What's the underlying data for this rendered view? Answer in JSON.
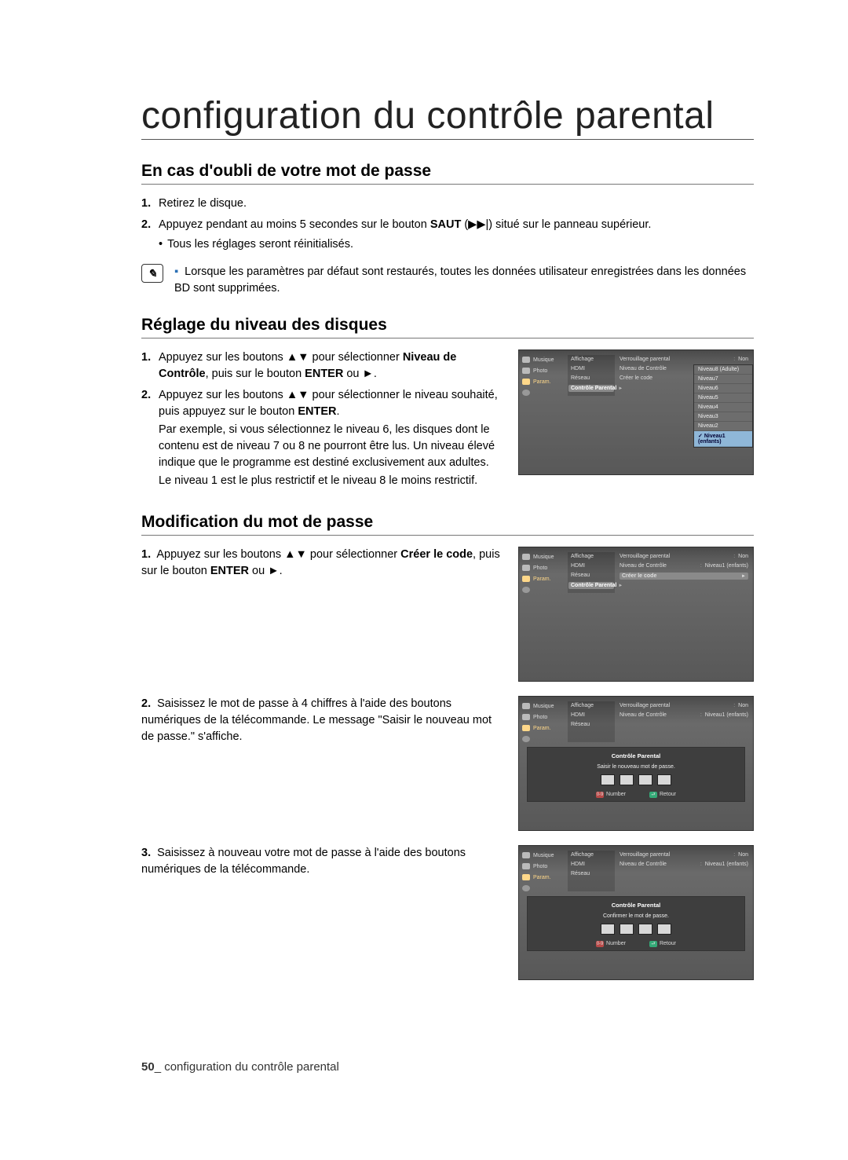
{
  "page": {
    "title": "configuration du contrôle parental",
    "footer_page": "50",
    "footer_sep": "_",
    "footer_text": "configuration du contrôle parental"
  },
  "s1": {
    "heading": "En cas d'oubli de votre mot de passe",
    "step1": "Retirez le disque.",
    "step2_a": "Appuyez pendant au moins 5 secondes sur le bouton ",
    "step2_b": "SAUT",
    "step2_c": " (▶▶|) situé sur le panneau supérieur.",
    "step2_bullet": "Tous les réglages seront réinitialisés.",
    "note": "Lorsque les paramètres par défaut sont restaurés, toutes les données utilisateur enregistrées dans les données BD sont supprimées."
  },
  "s2": {
    "heading": "Réglage du niveau des disques",
    "step1_a": "Appuyez sur les boutons ▲▼ pour sélectionner ",
    "step1_b": "Niveau de Contrôle",
    "step1_c": ", puis sur le bouton ",
    "step1_d": "ENTER",
    "step1_e": " ou ►.",
    "step2_a": "Appuyez sur les boutons ▲▼ pour sélectionner le niveau souhaité, puis appuyez sur le bouton ",
    "step2_b": "ENTER",
    "step2_c": ".",
    "step2_p1": "Par exemple, si vous sélectionnez le niveau 6, les disques dont le contenu est de niveau 7 ou 8 ne pourront être lus. Un niveau élevé indique que le programme est destiné exclusivement aux adultes.",
    "step2_p2": "Le niveau 1 est le plus restrictif et le niveau 8 le moins restrictif."
  },
  "s3": {
    "heading": "Modification du mot de passe",
    "step1_a": "Appuyez sur les boutons ▲▼ pour sélectionner ",
    "step1_b": "Créer le code",
    "step1_c": ", puis sur le bouton ",
    "step1_d": "ENTER",
    "step1_e": " ou ►.",
    "step2": "Saisissez le mot de passe à 4 chiffres à l'aide des boutons numériques de la télécommande. Le message \"Saisir le nouveau mot de passe.\" s'affiche.",
    "step3": "Saisissez à nouveau votre mot de passe à l'aide des boutons numériques de la télécommande."
  },
  "shot": {
    "side": {
      "music": "Musique",
      "photo": "Photo",
      "param": "Param."
    },
    "col1": {
      "affichage": "Affichage",
      "hdmi": "HDMI",
      "reseau": "Réseau",
      "cp": "Contrôle Parental",
      "chev": "►"
    },
    "kv": {
      "verr": "Verrouillage parental",
      "verr_v": "Non",
      "niv": "Niveau de Contrôle",
      "niv_v": "Niveau1 (enfants)",
      "code": "Créer le code",
      "sep": ":"
    },
    "levels": [
      "Niveau8 (Adulte)",
      "Niveau7",
      "Niveau6",
      "Niveau5",
      "Niveau4",
      "Niveau3",
      "Niveau2",
      "Niveau1 (enfants)"
    ],
    "modal": {
      "title": "Contrôle Parental",
      "msg1": "Saisir le nouveau mot de passe.",
      "msg2": "Confirmer le mot de passe.",
      "btn_num": "Number",
      "btn_ret": "Retour"
    }
  }
}
